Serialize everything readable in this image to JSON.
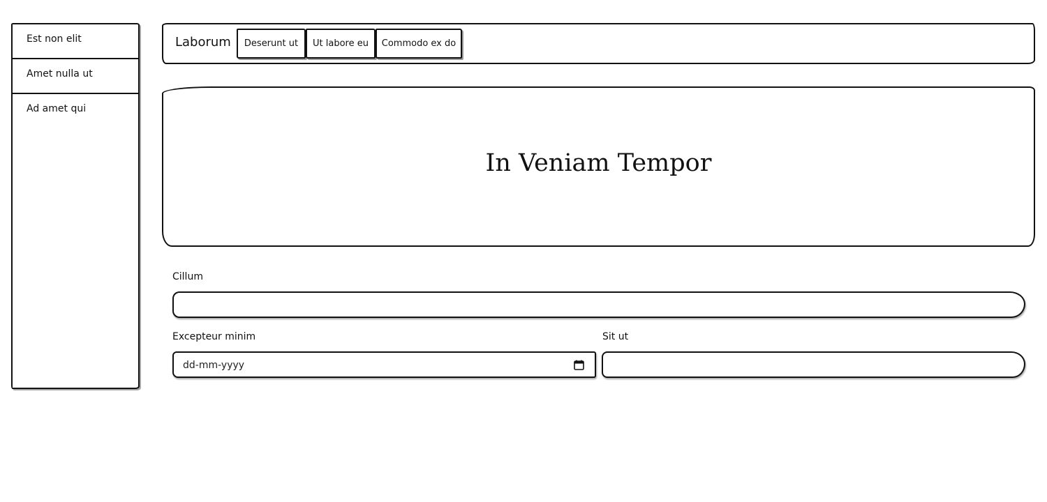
{
  "sidebar": {
    "items": [
      {
        "label": "Est non elit"
      },
      {
        "label": "Amet nulla ut"
      },
      {
        "label": "Ad amet qui"
      }
    ]
  },
  "topnav": {
    "brand": "Laborum",
    "buttons": [
      {
        "label": "Deserunt ut"
      },
      {
        "label": "Ut labore eu"
      },
      {
        "label": "Commodo ex do"
      }
    ]
  },
  "hero": {
    "title": "In Veniam Tempor"
  },
  "form": {
    "cillum": {
      "label": "Cillum",
      "value": ""
    },
    "excepteur": {
      "label": "Excepteur minim",
      "placeholder": "dd-mm-yyyy",
      "icon": "calendar-icon"
    },
    "sit": {
      "label": "Sit ut",
      "value": ""
    }
  }
}
